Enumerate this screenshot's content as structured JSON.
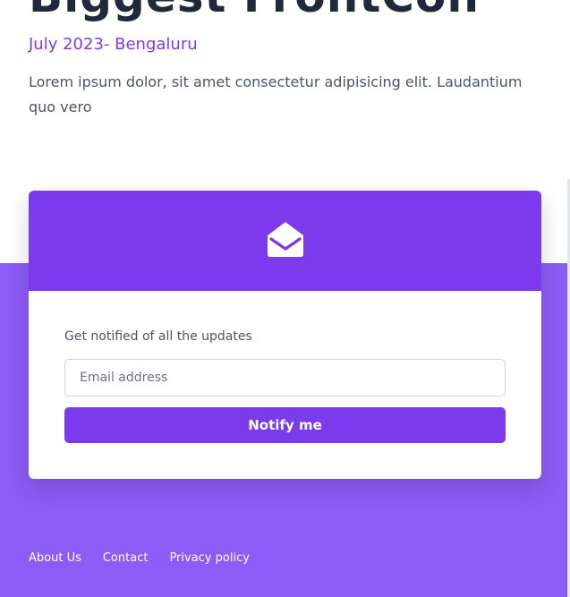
{
  "hero": {
    "title": "Biggest FrontCon",
    "subtitle": "July 2023- Bengaluru",
    "description": "Lorem ipsum dolor, sit amet consectetur adipisicing elit. Laudantium quo vero"
  },
  "signup": {
    "icon": "envelope-open-icon",
    "label": "Get notified of all the updates",
    "email_placeholder": "Email address",
    "email_value": "",
    "button_label": "Notify me"
  },
  "footer": {
    "links": [
      {
        "label": "About Us"
      },
      {
        "label": "Contact"
      },
      {
        "label": "Privacy policy"
      }
    ]
  },
  "colors": {
    "accent": "#7c3aed",
    "background_band": "#8b5cf6",
    "title_text": "#1f2937",
    "body_text": "#4b5563"
  }
}
